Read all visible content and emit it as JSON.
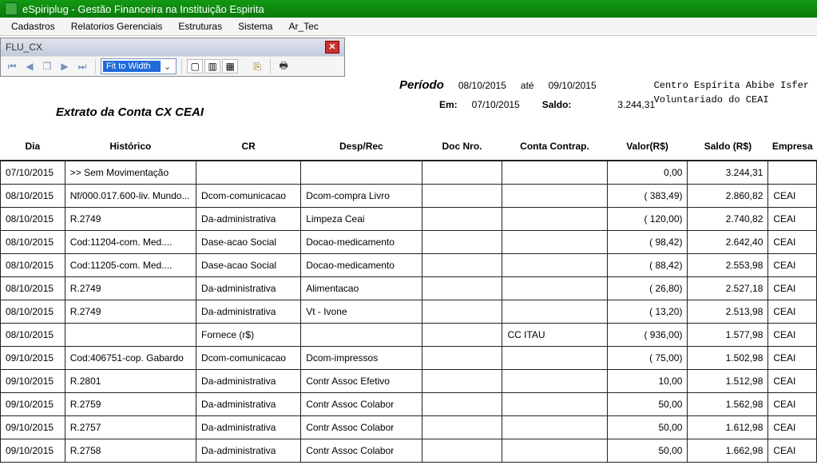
{
  "window": {
    "title": "eSpiriplug - Gestão Financeira na Instituição Espirita"
  },
  "menu": {
    "items": [
      "Cadastros",
      "Relatorios Gerenciais",
      "Estruturas",
      "Sistema",
      "Ar_Tec"
    ]
  },
  "subwindow": {
    "title": "FLU_CX"
  },
  "toolbar": {
    "fit_label": "Fit to Width"
  },
  "report": {
    "extrato_title": "Extrato da Conta   CX  CEAI",
    "periodo_label": "Período",
    "date_from": "08/10/2015",
    "ate_label": "até",
    "date_to": "09/10/2015",
    "em_label": "Em:",
    "em_date": "07/10/2015",
    "saldo_label": "Saldo:",
    "saldo_value": "3.244,31",
    "org_line1": "Centro Espírita Abibe Isfer",
    "org_line2": "Voluntariado do CEAI"
  },
  "columns": {
    "dia": "Dia",
    "historico": "Histórico",
    "cr": "CR",
    "desprec": "Desp/Rec",
    "doc": "Doc Nro.",
    "contrap": "Conta Contrap.",
    "valor": "Valor(R$)",
    "saldo": "Saldo (R$)",
    "empresa": "Empresa"
  },
  "rows": [
    {
      "dia": "07/10/2015",
      "historico": ">> Sem Movimentação",
      "cr": "",
      "desprec": "",
      "doc": "",
      "contrap": "",
      "valor": "0,00",
      "saldo": "3.244,31",
      "empresa": ""
    },
    {
      "dia": "08/10/2015",
      "historico": "Nf/000.017.600-liv. Mundo...",
      "cr": "Dcom-comunicacao",
      "desprec": "Dcom-compra Livro",
      "doc": "",
      "contrap": "",
      "valor": "(   383,49)",
      "saldo": "2.860,82",
      "empresa": "CEAI"
    },
    {
      "dia": "08/10/2015",
      "historico": "R.2749",
      "cr": "Da-administrativa",
      "desprec": "Limpeza Ceai",
      "doc": "",
      "contrap": "",
      "valor": "(   120,00)",
      "saldo": "2.740,82",
      "empresa": "CEAI"
    },
    {
      "dia": "08/10/2015",
      "historico": "Cod:11204-com. Med....",
      "cr": "Dase-acao Social",
      "desprec": "Docao-medicamento",
      "doc": "",
      "contrap": "",
      "valor": "(    98,42)",
      "saldo": "2.642,40",
      "empresa": "CEAI"
    },
    {
      "dia": "08/10/2015",
      "historico": "Cod:11205-com. Med....",
      "cr": "Dase-acao Social",
      "desprec": "Docao-medicamento",
      "doc": "",
      "contrap": "",
      "valor": "(    88,42)",
      "saldo": "2.553,98",
      "empresa": "CEAI"
    },
    {
      "dia": "08/10/2015",
      "historico": "R.2749",
      "cr": "Da-administrativa",
      "desprec": "Alimentacao",
      "doc": "",
      "contrap": "",
      "valor": "(    26,80)",
      "saldo": "2.527,18",
      "empresa": "CEAI"
    },
    {
      "dia": "08/10/2015",
      "historico": "R.2749",
      "cr": "Da-administrativa",
      "desprec": "Vt - Ivone",
      "doc": "",
      "contrap": "",
      "valor": "(    13,20)",
      "saldo": "2.513,98",
      "empresa": "CEAI"
    },
    {
      "dia": "08/10/2015",
      "historico": "",
      "cr": "Fornece (r$)",
      "desprec": "",
      "doc": "",
      "contrap": "CC  ITAU",
      "valor": "(   936,00)",
      "saldo": "1.577,98",
      "empresa": "CEAI"
    },
    {
      "dia": "09/10/2015",
      "historico": "Cod:406751-cop. Gabardo",
      "cr": "Dcom-comunicacao",
      "desprec": "Dcom-impressos",
      "doc": "",
      "contrap": "",
      "valor": "(    75,00)",
      "saldo": "1.502,98",
      "empresa": "CEAI"
    },
    {
      "dia": "09/10/2015",
      "historico": "R.2801",
      "cr": "Da-administrativa",
      "desprec": "Contr Assoc Efetivo",
      "doc": "",
      "contrap": "",
      "valor": "10,00",
      "saldo": "1.512,98",
      "empresa": "CEAI"
    },
    {
      "dia": "09/10/2015",
      "historico": "R.2759",
      "cr": "Da-administrativa",
      "desprec": "Contr Assoc Colabor",
      "doc": "",
      "contrap": "",
      "valor": "50,00",
      "saldo": "1.562,98",
      "empresa": "CEAI"
    },
    {
      "dia": "09/10/2015",
      "historico": "R.2757",
      "cr": "Da-administrativa",
      "desprec": "Contr Assoc Colabor",
      "doc": "",
      "contrap": "",
      "valor": "50,00",
      "saldo": "1.612,98",
      "empresa": "CEAI"
    },
    {
      "dia": "09/10/2015",
      "historico": "R.2758",
      "cr": "Da-administrativa",
      "desprec": "Contr Assoc Colabor",
      "doc": "",
      "contrap": "",
      "valor": "50,00",
      "saldo": "1.662,98",
      "empresa": "CEAI"
    }
  ]
}
